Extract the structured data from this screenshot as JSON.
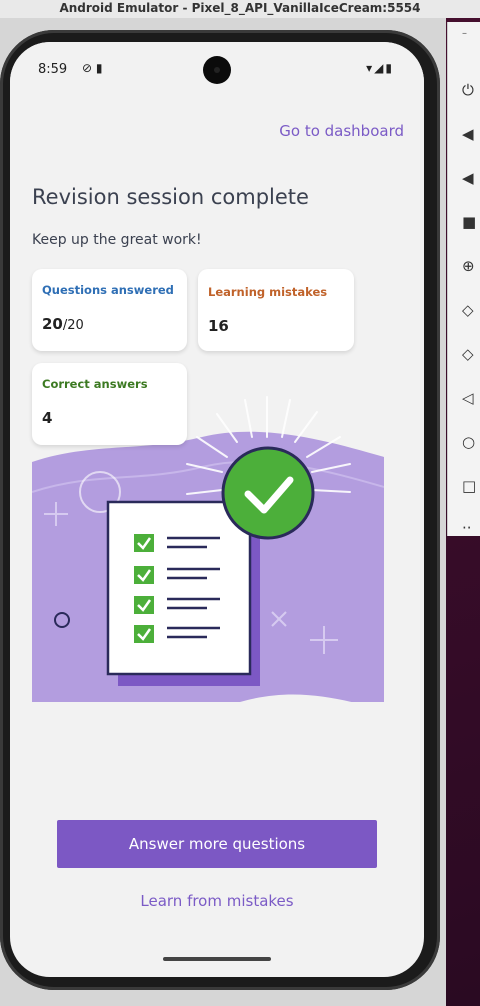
{
  "window": {
    "title": "Android Emulator - Pixel_8_API_VanillaIceCream:5554"
  },
  "status_bar": {
    "time": "8:59",
    "left_icons": "⊘ ▮",
    "right_icons": "▾◢▮"
  },
  "app": {
    "dashboard_link": "Go to dashboard",
    "title": "Revision session complete",
    "subtitle": "Keep up the great work!",
    "stats": {
      "questions_answered": {
        "label": "Questions answered",
        "value": "20",
        "total": "/20"
      },
      "learning_mistakes": {
        "label": "Learning mistakes",
        "value": "16"
      },
      "correct_answers": {
        "label": "Correct answers",
        "value": "4"
      }
    },
    "primary_button": "Answer more questions",
    "secondary_button": "Learn from mistakes"
  },
  "emulator_toolbar": {
    "items": [
      "power-icon",
      "volume-up-icon",
      "volume-down-icon",
      "camera-icon",
      "zoom-icon",
      "rotate-left-icon",
      "rotate-right-icon",
      "back-icon",
      "home-icon",
      "overview-icon",
      "more-icon"
    ]
  },
  "colors": {
    "accent": "#7c58c4",
    "questions_label": "#2f6fb5",
    "mistakes_label": "#c0622a",
    "correct_label": "#3c7a22",
    "checkmark_green": "#4caf3a",
    "illustration_purple": "#b39ddf"
  }
}
